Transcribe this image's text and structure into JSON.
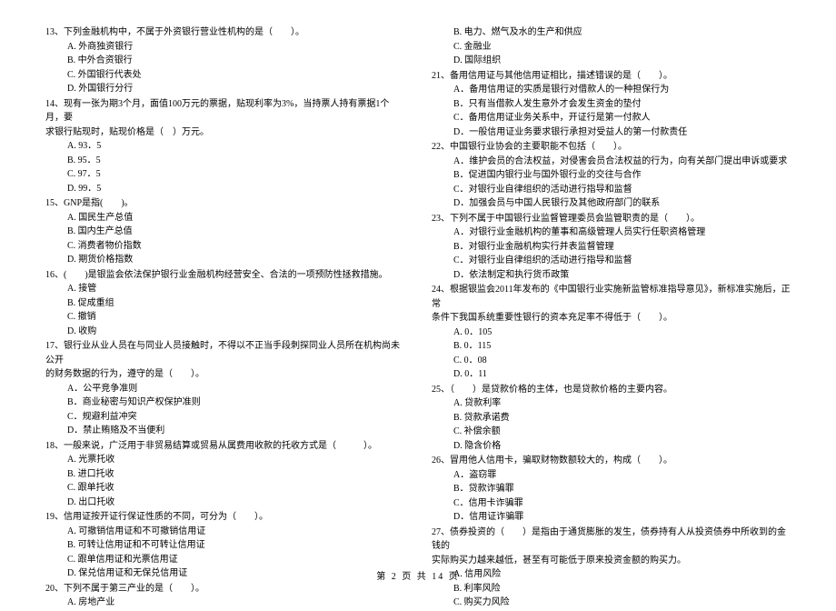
{
  "footer": "第 2 页 共 14 页",
  "left": {
    "q13": {
      "text": "13、下列金融机构中，不属于外资银行营业性机构的是（　　）。",
      "a": "A. 外商独资银行",
      "b": "B. 中外合资银行",
      "c": "C. 外国银行代表处",
      "d": "D. 外国银行分行"
    },
    "q14": {
      "line1": "14、现有一张为期3个月，面值100万元的票据，贴现利率为3%，当持票人持有票据1个月，要",
      "line2": "求银行贴现时，贴现价格是（　）万元。",
      "a": "A. 93．5",
      "b": "B. 95．5",
      "c": "C. 97．5",
      "d": "D. 99．5"
    },
    "q15": {
      "text": "15、GNP是指(　　)。",
      "a": "A. 国民生产总值",
      "b": "B. 国内生产总值",
      "c": "C. 消费者物价指数",
      "d": "D. 期货价格指数"
    },
    "q16": {
      "text": "16、(　　)是银监会依法保护银行业金融机构经营安全、合法的一项预防性拯救措施。",
      "a": "A. 接管",
      "b": "B. 促成重组",
      "c": "C. 撤销",
      "d": "D. 收购"
    },
    "q17": {
      "line1": "17、银行业从业人员在与同业人员接触时，不得以不正当手段刺探同业人员所在机构尚未公开",
      "line2": "的财务数据的行为，遵守的是（　　）。",
      "a": "A．公平竞争准则",
      "b": "B．商业秘密与知识产权保护准则",
      "c": "C．规避利益冲突",
      "d": "D．禁止贿赂及不当便利"
    },
    "q18": {
      "text": "18、一般来说，广泛用于非贸易结算或贸易从属费用收款的托收方式是（　　　）。",
      "a": "A. 光票托收",
      "b": "B. 进口托收",
      "c": "C. 跟单托收",
      "d": "D. 出口托收"
    },
    "q19": {
      "text": "19、信用证按开证行保证性质的不同，可分为（　　）。",
      "a": "A. 可撤销信用证和不可撤销信用证",
      "b": "B. 可转让信用证和不可转让信用证",
      "c": "C. 跟单信用证和光票信用证",
      "d": "D. 保兑信用证和无保兑信用证"
    },
    "q20": {
      "text": "20、下列不属于第三产业的是（　　）。",
      "a": "A. 房地产业"
    }
  },
  "right": {
    "q20cont": {
      "b": "B. 电力、燃气及水的生产和供应",
      "c": "C. 金融业",
      "d": "D. 国际组织"
    },
    "q21": {
      "text": "21、备用信用证与其他信用证相比，描述错误的是（　　）。",
      "a": "A．备用信用证的实质是银行对借款人的一种担保行为",
      "b": "B．只有当借款人发生意外才会发生资金的垫付",
      "c": "C．备用信用证业务关系中，开证行是第一付款人",
      "d": "D．一般信用证业务要求银行承担对受益人的第一付款责任"
    },
    "q22": {
      "text": "22、中国银行业协会的主要职能不包括（　　）。",
      "a": "A．维护会员的合法权益，对侵害会员合法权益的行为，向有关部门提出申诉或要求",
      "b": "B．促进国内银行业与国外银行业的交往与合作",
      "c": "C．对银行业自律组织的活动进行指导和监督",
      "d": "D．加强会员与中国人民银行及其他政府部门的联系"
    },
    "q23": {
      "text": "23、下列不属于中国银行业监督管理委员会监管职责的是（　　）。",
      "a": "A．对银行业金融机构的董事和高级管理人员实行任职资格管理",
      "b": "B．对银行业金融机构实行并表监督管理",
      "c": "C．对银行业自律组织的活动进行指导和监督",
      "d": "D．依法制定和执行货币政策"
    },
    "q24": {
      "line1": "24、根据银监会2011年发布的《中国银行业实施新监管标准指导意见》，新标准实施后，正常",
      "line2": "条件下我国系统重要性银行的资本充足率不得低于（　　）。",
      "a": "A. 0．105",
      "b": "B. 0．115",
      "c": "C. 0．08",
      "d": "D. 0．11"
    },
    "q25": {
      "text": "25、（　　）是贷款价格的主体，也是贷款价格的主要内容。",
      "a": "A. 贷款利率",
      "b": "B. 贷款承诺费",
      "c": "C. 补偿余额",
      "d": "D. 隐含价格"
    },
    "q26": {
      "text": "26、冒用他人信用卡，骗取财物数额较大的，构成（　　）。",
      "a": "A．盗窃罪",
      "b": "B．贷款诈骗罪",
      "c": "C．信用卡诈骗罪",
      "d": "D．信用证诈骗罪"
    },
    "q27": {
      "line1": "27、债券投资的（　　）是指由于通货膨胀的发生，债券持有人从投资债券中所收到的金钱的",
      "line2": "实际购买力越来越低，甚至有可能低于原来投资金额的购买力。",
      "a": "A. 信用风险",
      "b": "B. 利率风险",
      "c": "C. 购买力风险"
    }
  }
}
